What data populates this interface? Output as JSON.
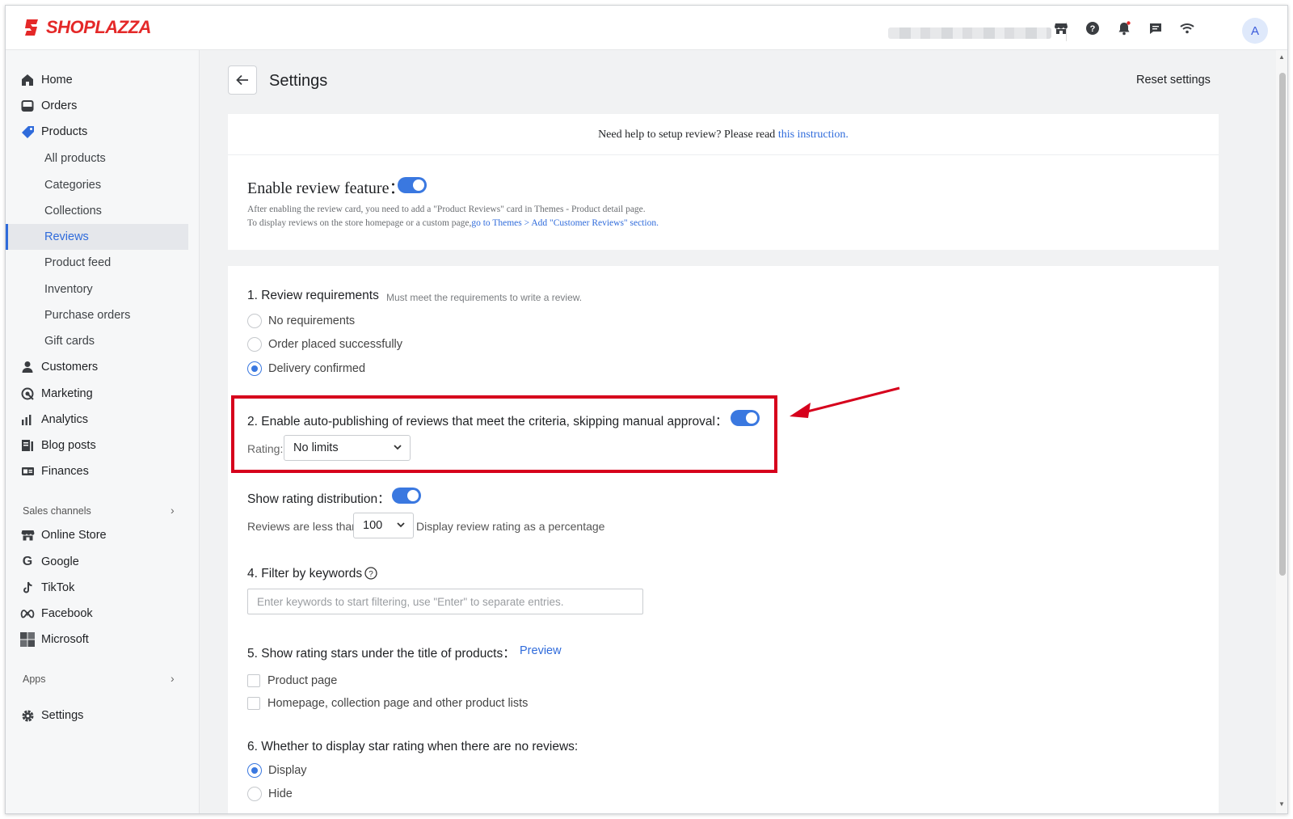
{
  "header": {
    "logo_text": "SHOPLAZZA",
    "brand_color": "#e42828",
    "avatar_letter": "A",
    "icons": [
      "store-icon",
      "help-icon",
      "bell-icon",
      "chat-icon",
      "wifi-icon"
    ]
  },
  "sidebar": {
    "items": [
      {
        "label": "Home",
        "icon": "home-icon"
      },
      {
        "label": "Orders",
        "icon": "orders-icon"
      },
      {
        "label": "Products",
        "icon": "tag-icon"
      },
      {
        "label": "All products"
      },
      {
        "label": "Categories"
      },
      {
        "label": "Collections"
      },
      {
        "label": "Reviews",
        "active": true
      },
      {
        "label": "Product feed"
      },
      {
        "label": "Inventory"
      },
      {
        "label": "Purchase orders"
      },
      {
        "label": "Gift cards"
      },
      {
        "label": "Customers",
        "icon": "person-icon"
      },
      {
        "label": "Marketing",
        "icon": "marketing-icon"
      },
      {
        "label": "Analytics",
        "icon": "bar-chart-icon"
      },
      {
        "label": "Blog posts",
        "icon": "blog-icon"
      },
      {
        "label": "Finances",
        "icon": "finances-icon"
      }
    ],
    "sales_channels_label": "Sales channels",
    "channels": [
      {
        "label": "Online Store",
        "icon": "store-icon"
      },
      {
        "label": "Google",
        "icon": "google-icon"
      },
      {
        "label": "TikTok",
        "icon": "tiktok-icon"
      },
      {
        "label": "Facebook",
        "icon": "meta-icon"
      },
      {
        "label": "Microsoft",
        "icon": "microsoft-icon"
      }
    ],
    "apps_label": "Apps",
    "settings_label": "Settings",
    "active_color": "#2f6bdb"
  },
  "page": {
    "title": "Settings",
    "reset_label": "Reset settings"
  },
  "help": {
    "text": "Need help to setup review? Please read ",
    "link": "this instruction."
  },
  "enable": {
    "label": "Enable review feature：",
    "note1": "After enabling the review card, you need to add a \"Product Reviews\" card in Themes - Product detail page.",
    "note2_prefix": "To display reviews on the store homepage or a custom page,",
    "note2_link": "go to Themes > Add \"Customer Reviews\" section."
  },
  "requirements": {
    "title": "1. Review requirements",
    "hint": "Must meet the requirements to write a review.",
    "options": [
      "No requirements",
      "Order placed successfully",
      "Delivery confirmed"
    ],
    "selected": "Delivery confirmed"
  },
  "auto_publish": {
    "title": "2. Enable auto-publishing of reviews that meet the criteria, skipping manual approval：",
    "rating_label": "Rating:",
    "rating_value": "No limits"
  },
  "distribution": {
    "title": "Show rating distribution：",
    "prefix": "Reviews are less than",
    "value": "100",
    "suffix": "Display review rating as a percentage"
  },
  "keywords": {
    "title": "4. Filter by keywords",
    "placeholder": "Enter keywords to start filtering, use \"Enter\" to separate entries."
  },
  "stars": {
    "title": "5. Show rating stars under the title of products：",
    "preview": "Preview",
    "options": [
      "Product page",
      "Homepage, collection page and other product lists"
    ]
  },
  "no_reviews": {
    "title": "6. Whether to display star rating when there are no reviews:",
    "options": [
      "Display",
      "Hide"
    ],
    "selected": "Display"
  },
  "annotation_color": "#d6001c",
  "toggle_color": "#3a78e0"
}
